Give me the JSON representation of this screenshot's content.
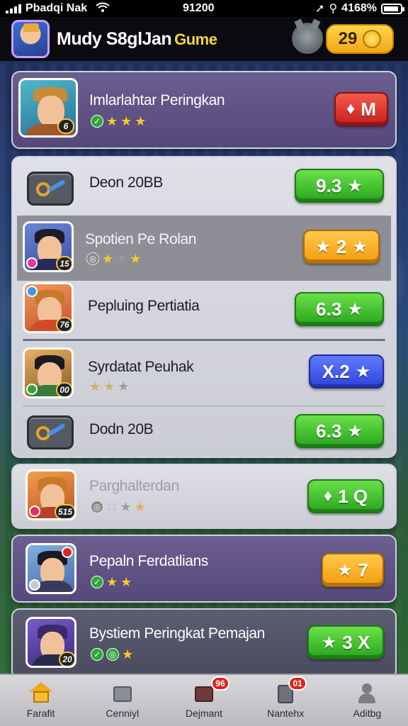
{
  "status_bar": {
    "carrier": "Pbadqi Nak",
    "time": "91200",
    "battery": "4168%"
  },
  "header": {
    "title": "Mudy S8glJan",
    "title_accent": "Gume",
    "coins": "29"
  },
  "featured": {
    "name": "Imlarlahtar Peringkan",
    "stars": 3,
    "action_label": "M"
  },
  "list": [
    {
      "name": "Deon 20BB",
      "score": "9.3",
      "color": "green",
      "stars": 0,
      "icon": "key-icon"
    },
    {
      "name": "Spotien Pe Rolan",
      "score": "2",
      "color": "orange",
      "level": "15",
      "stars": 2,
      "selected": true
    },
    {
      "name": "Pepluing Pertiatia",
      "score": "6.3",
      "color": "green",
      "level": "76",
      "stars": 0
    },
    {
      "name": "Syrdatat Peuhak",
      "score": "X.2",
      "color": "blue",
      "level": "00",
      "stars": 2
    },
    {
      "name": "Dodn 20B",
      "score": "6.3",
      "color": "green",
      "stars": 0,
      "icon": "key-icon"
    }
  ],
  "cards": [
    {
      "name": "Parghalterdan",
      "score": "1 Q",
      "color": "green",
      "level": "515",
      "stat": "11"
    },
    {
      "name": "Pepaln Ferdatlians",
      "score": "7",
      "color": "orange",
      "stars": 2
    },
    {
      "name": "Bystiem Peringkat Pemajan",
      "score": "3 X",
      "color": "green",
      "level": "20",
      "stars": 1
    }
  ],
  "nav": [
    {
      "label": "Farafit",
      "icon": "home-icon"
    },
    {
      "label": "Cenniyl",
      "icon": "chest-icon"
    },
    {
      "label": "Dejmant",
      "icon": "shop-icon",
      "badge": "96"
    },
    {
      "label": "Nantehx",
      "icon": "news-icon",
      "badge": "01"
    },
    {
      "label": "Aditbg",
      "icon": "profile-icon"
    }
  ]
}
